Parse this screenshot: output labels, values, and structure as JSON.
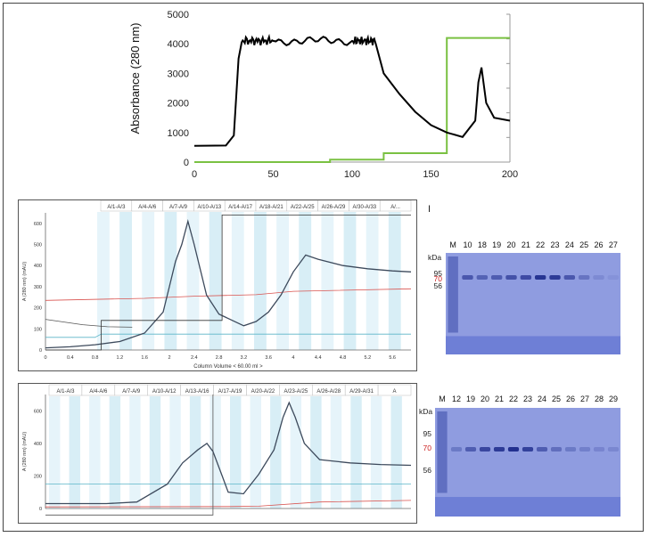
{
  "figure": {
    "top_chart": {
      "y_axis_label": "Absorbance (280 nm)",
      "y_ticks": [
        "0",
        "1000",
        "2000",
        "3000",
        "4000",
        "5000"
      ],
      "x_ticks": [
        "0",
        "50",
        "100",
        "150",
        "200"
      ],
      "colors": {
        "absorbance": "#000000",
        "gradient": "#7ac142",
        "axes": "#999999"
      }
    },
    "chrom1": {
      "fraction_labels": [
        "A/1-A/3",
        "A/4-A/6",
        "A/7-A/9",
        "A/10-A/13",
        "A/14-A/17",
        "A/18-A/21",
        "A/22-A/25",
        "A/26-A/29",
        "A/30-A/33",
        "A/..."
      ],
      "y_label": "A (280 nm) (mAU)",
      "y_ticks": [
        "0",
        "100",
        "200",
        "300",
        "400",
        "500",
        "600"
      ],
      "x_ticks": [
        "0",
        "0.4",
        "0.8",
        "1.2",
        "1.6",
        "2",
        "2.4",
        "2.8",
        "3.2",
        "3.6",
        "4",
        "4.4",
        "4.8",
        "5.2",
        "5.6"
      ],
      "x_label": "Column Volume < 60.00 ml >"
    },
    "chrom2": {
      "fraction_labels": [
        "A/1-A/3",
        "A/4-A/6",
        "A/7-A/9",
        "A/10-A/12",
        "A/13-A/16",
        "A/17-A/19",
        "A/20-A/22",
        "A/23-A/25",
        "A/26-A/28",
        "A/29-A/31",
        "A"
      ],
      "y_label": "A (280 nm) (mAU)",
      "y_ticks": [
        "0",
        "200",
        "400",
        "600"
      ]
    },
    "gel1": {
      "panel_mark": "I",
      "unit": "kDa",
      "lanes": [
        "M",
        "10",
        "18",
        "19",
        "20",
        "21",
        "22",
        "23",
        "24",
        "25",
        "26",
        "27"
      ],
      "markers": [
        {
          "label": "95",
          "red": false
        },
        {
          "label": "70",
          "red": true
        },
        {
          "label": "56",
          "red": false
        }
      ],
      "band_intensity": [
        0,
        0.6,
        0.5,
        0.55,
        0.65,
        0.7,
        0.9,
        0.85,
        0.6,
        0.35,
        0.15,
        0.08
      ]
    },
    "gel2": {
      "unit": "kDa",
      "lanes": [
        "M",
        "12",
        "19",
        "20",
        "21",
        "22",
        "23",
        "24",
        "25",
        "26",
        "27",
        "28",
        "29"
      ],
      "markers": [
        {
          "label": "95",
          "red": false
        },
        {
          "label": "70",
          "red": true
        },
        {
          "label": "56",
          "red": false
        }
      ],
      "band_intensity": [
        0,
        0.3,
        0.55,
        0.75,
        0.85,
        0.95,
        0.8,
        0.55,
        0.4,
        0.3,
        0.25,
        0.2,
        0.18
      ]
    }
  },
  "chart_data": [
    {
      "type": "line",
      "title": "",
      "xlabel": "",
      "ylabel": "Absorbance (280 nm)",
      "xlim": [
        0,
        200
      ],
      "ylim": [
        0,
        5000
      ],
      "series": [
        {
          "x": [
            0,
            20,
            25,
            28,
            30,
            50,
            100,
            115,
            120,
            130,
            140,
            150,
            160,
            170,
            178,
            180,
            182,
            185,
            190,
            200
          ],
          "y": [
            550,
            560,
            900,
            3500,
            4050,
            4100,
            4100,
            4000,
            3000,
            2300,
            1700,
            1250,
            1000,
            850,
            1400,
            2700,
            3200,
            2000,
            1500,
            1400
          ]
        },
        {
          "x": [
            0,
            80,
            86,
            86,
            120,
            120,
            160,
            160,
            200
          ],
          "y": [
            0,
            0,
            0,
            80,
            80,
            300,
            300,
            4200,
            4200
          ]
        }
      ]
    },
    {
      "type": "line",
      "title": "",
      "xlabel": "Column Volume < 60.00 ml >",
      "ylabel": "A (280 nm) (mAU)",
      "xlim": [
        0,
        5.9
      ],
      "ylim": [
        0,
        650
      ],
      "series": [
        {
          "x": [
            0,
            0.4,
            0.8,
            1.2,
            1.6,
            1.9,
            2.0,
            2.1,
            2.2,
            2.3,
            2.4,
            2.6,
            2.8,
            3.2,
            3.4,
            3.6,
            3.8,
            4.0,
            4.2,
            4.4,
            4.8,
            5.2,
            5.6,
            5.9
          ],
          "y": [
            10,
            15,
            25,
            40,
            80,
            180,
            300,
            420,
            500,
            610,
            500,
            260,
            170,
            115,
            135,
            180,
            260,
            370,
            450,
            430,
            400,
            385,
            375,
            370
          ]
        },
        {
          "x": [
            0,
            0.9,
            0.9,
            2.85,
            2.85,
            5.9
          ],
          "y": [
            0,
            0,
            140,
            140,
            640,
            640
          ]
        }
      ]
    },
    {
      "type": "line",
      "title": "",
      "xlabel": "",
      "ylabel": "A (280 nm) (mAU)",
      "xlim": [
        0,
        12
      ],
      "ylim": [
        0,
        700
      ],
      "series": [
        {
          "x": [
            0,
            1,
            2,
            3,
            4,
            4.5,
            5,
            5.3,
            5.5,
            5.8,
            6,
            6.5,
            7,
            7.5,
            7.8,
            8,
            8.2,
            8.5,
            9,
            10,
            11,
            12
          ],
          "y": [
            30,
            30,
            30,
            40,
            150,
            280,
            360,
            400,
            350,
            200,
            100,
            90,
            210,
            360,
            560,
            650,
            560,
            400,
            300,
            280,
            270,
            265
          ]
        }
      ]
    }
  ]
}
